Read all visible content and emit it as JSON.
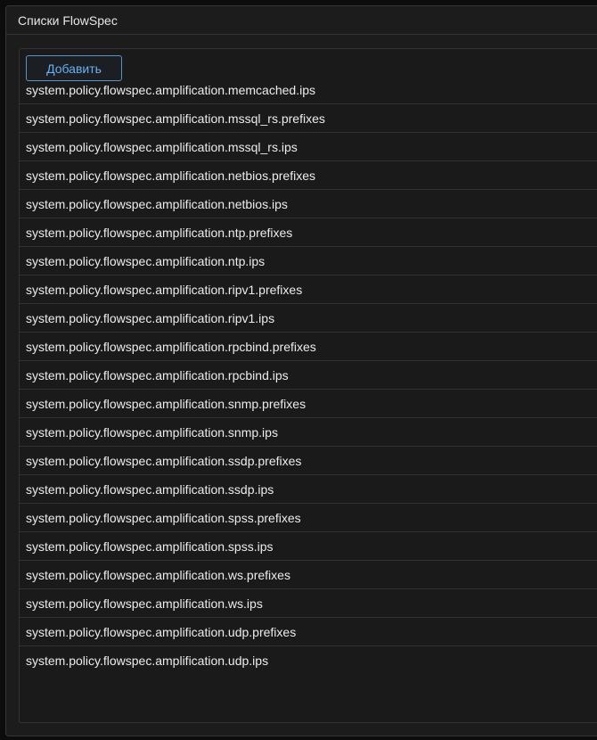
{
  "panel": {
    "title": "Списки FlowSpec"
  },
  "toolbar": {
    "add_label": "Добавить"
  },
  "list": {
    "items": [
      "system.policy.flowspec.amplification.memcached.ips",
      "system.policy.flowspec.amplification.mssql_rs.prefixes",
      "system.policy.flowspec.amplification.mssql_rs.ips",
      "system.policy.flowspec.amplification.netbios.prefixes",
      "system.policy.flowspec.amplification.netbios.ips",
      "system.policy.flowspec.amplification.ntp.prefixes",
      "system.policy.flowspec.amplification.ntp.ips",
      "system.policy.flowspec.amplification.ripv1.prefixes",
      "system.policy.flowspec.amplification.ripv1.ips",
      "system.policy.flowspec.amplification.rpcbind.prefixes",
      "system.policy.flowspec.amplification.rpcbind.ips",
      "system.policy.flowspec.amplification.snmp.prefixes",
      "system.policy.flowspec.amplification.snmp.ips",
      "system.policy.flowspec.amplification.ssdp.prefixes",
      "system.policy.flowspec.amplification.ssdp.ips",
      "system.policy.flowspec.amplification.spss.prefixes",
      "system.policy.flowspec.amplification.spss.ips",
      "system.policy.flowspec.amplification.ws.prefixes",
      "system.policy.flowspec.amplification.ws.ips",
      "system.policy.flowspec.amplification.udp.prefixes",
      "system.policy.flowspec.amplification.udp.ips"
    ]
  }
}
